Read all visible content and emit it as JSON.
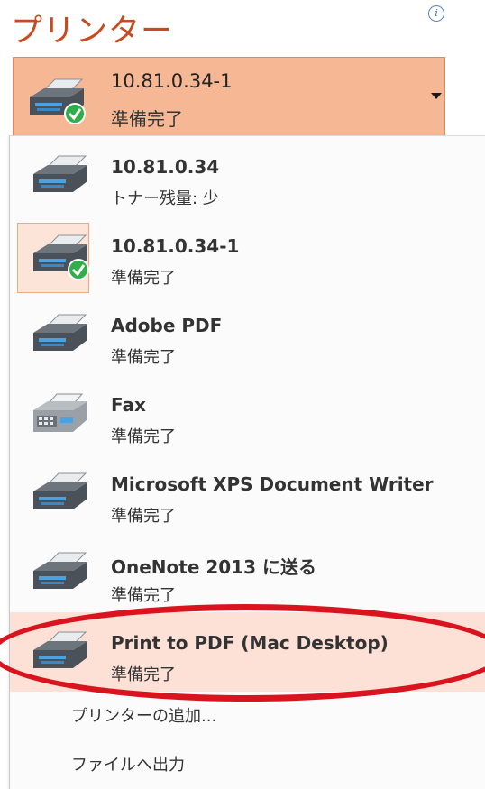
{
  "title": "プリンター",
  "info_icon_glyph": "i",
  "selected_printer": {
    "name": "10.81.0.34-1",
    "status": "準備完了",
    "icon": "printer-ready-icon"
  },
  "printers": [
    {
      "name": "10.81.0.34",
      "status": "トナー残量: 少",
      "icon": "printer-icon"
    },
    {
      "name": "10.81.0.34-1",
      "status": "準備完了",
      "icon": "printer-ready-icon"
    },
    {
      "name": "Adobe PDF",
      "status": "準備完了",
      "icon": "printer-icon"
    },
    {
      "name": "Fax",
      "status": "準備完了",
      "icon": "fax-icon"
    },
    {
      "name": "Microsoft XPS Document Writer",
      "status": "準備完了",
      "icon": "printer-icon"
    },
    {
      "name": "OneNote 2013 に送る",
      "status": "準備完了",
      "icon": "printer-icon"
    },
    {
      "name": "Print to PDF (Mac Desktop)",
      "status": "準備完了",
      "icon": "printer-icon"
    }
  ],
  "commands": {
    "add_printer": "プリンターの追加...",
    "print_to_file": "ファイルへ出力"
  },
  "colors": {
    "title": "#c94a1e",
    "selector_bg": "#f6b795",
    "highlight_bg": "#fde0d6",
    "annotation_oval": "#d9141e"
  }
}
